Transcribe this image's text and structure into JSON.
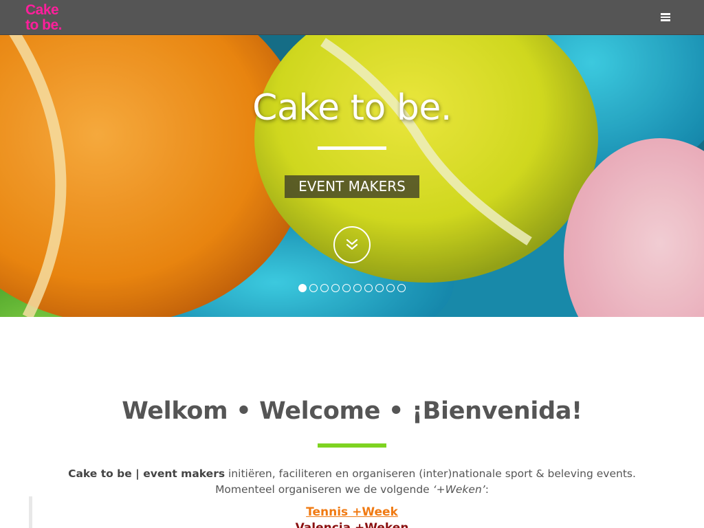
{
  "header": {
    "logo_line1": "Cake",
    "logo_line2": "to be.",
    "menu_icon": "hamburger-menu-icon"
  },
  "hero": {
    "title": "Cake to be.",
    "badge": "EVENT MAKERS",
    "scroll_icon": "double-chevron-down-icon",
    "slide_count": 10,
    "active_slide": 1
  },
  "main": {
    "heading": "Welkom • Welcome • ¡Bienvenida!",
    "intro_bold": "Cake to be | event makers",
    "intro_rest": " initiëren, faciliteren en organiseren (inter)nationale sport & beleving events.",
    "intro_line2": "Momenteel organiseren we de volgende ",
    "intro_emph": "‘+Weken’",
    "intro_colon": ":",
    "events": [
      {
        "label": "Tennis +Week"
      },
      {
        "label": "Valencia +Weken"
      }
    ]
  },
  "colors": {
    "brand": "#ff1f9c",
    "header_bg": "#555555",
    "accent_green": "#7ed321",
    "link_orange": "#f07a12",
    "link_dark_red": "#8a1010"
  }
}
